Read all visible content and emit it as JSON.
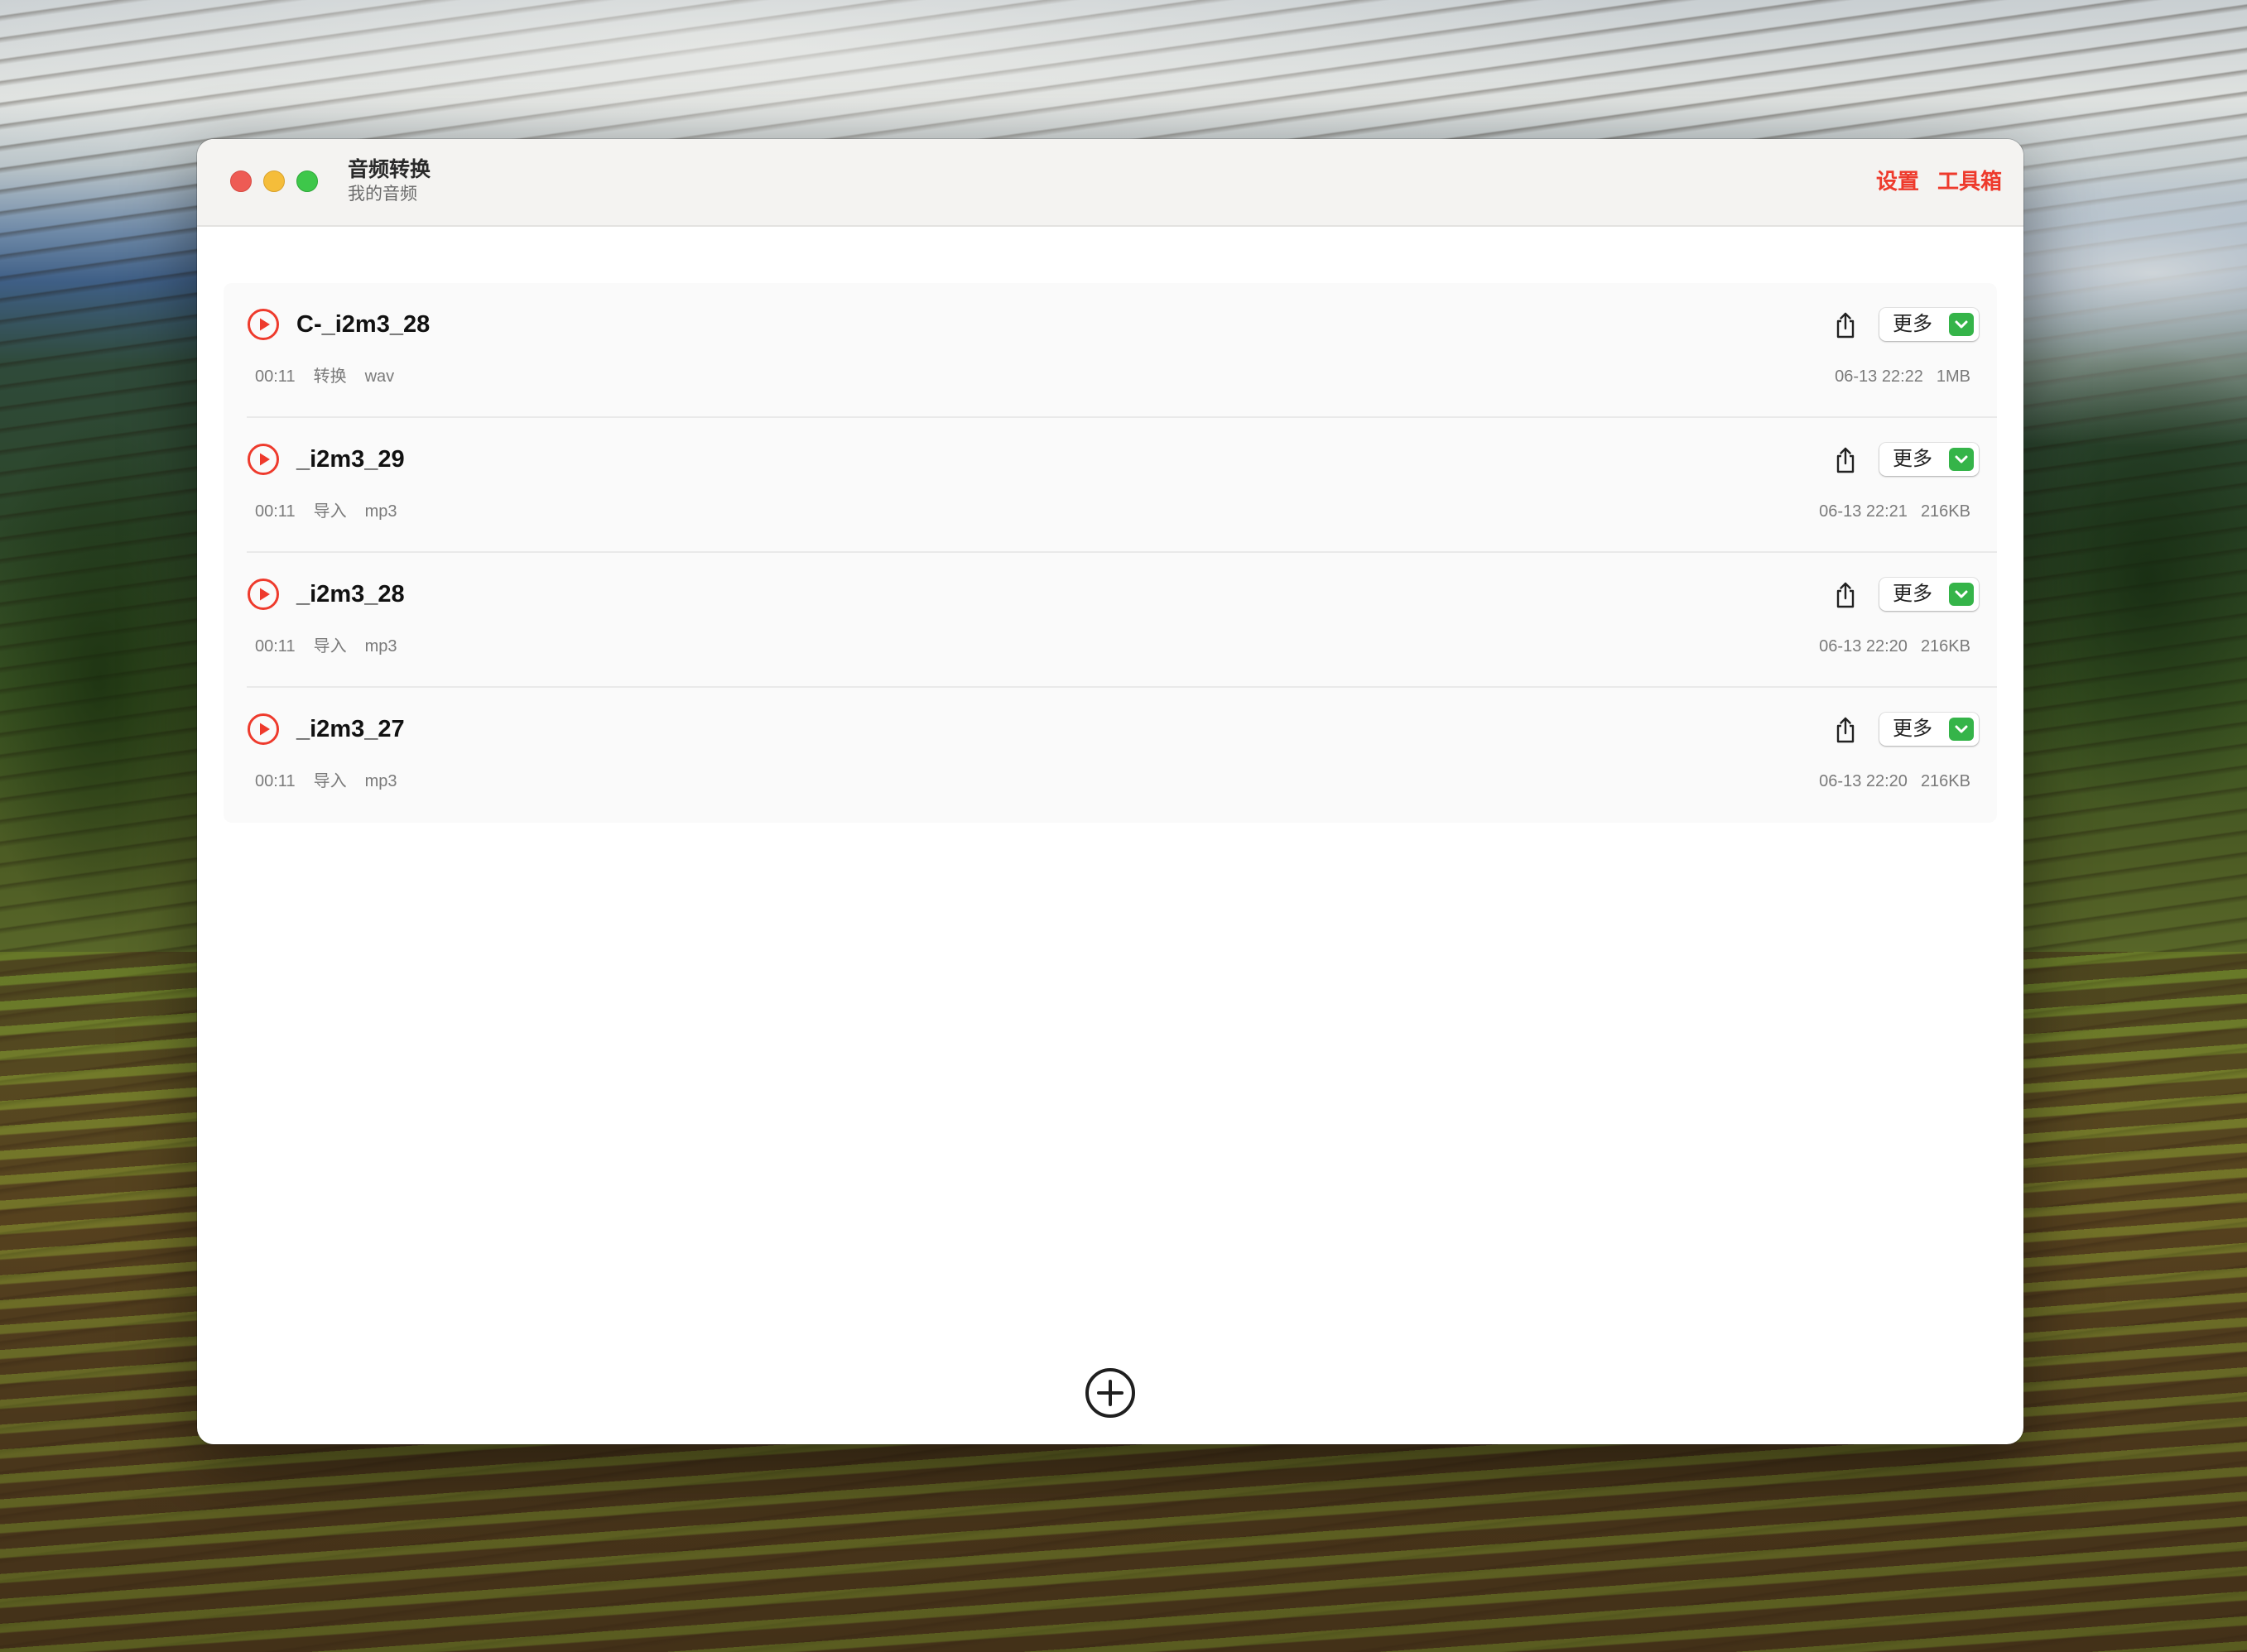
{
  "window": {
    "title": "音频转换",
    "subtitle": "我的音频"
  },
  "header": {
    "settings_label": "设置",
    "toolbox_label": "工具箱",
    "accent_color": "#ee3a2c"
  },
  "recordings": [
    {
      "name": "C-_i2m3_28",
      "duration": "00:11",
      "source": "转换",
      "format": "wav",
      "date": "06-13 22:22",
      "size": "1MB",
      "more_label": "更多"
    },
    {
      "name": "_i2m3_29",
      "duration": "00:11",
      "source": "导入",
      "format": "mp3",
      "date": "06-13 22:21",
      "size": "216KB",
      "more_label": "更多"
    },
    {
      "name": "_i2m3_28",
      "duration": "00:11",
      "source": "导入",
      "format": "mp3",
      "date": "06-13 22:20",
      "size": "216KB",
      "more_label": "更多"
    },
    {
      "name": "_i2m3_27",
      "duration": "00:11",
      "source": "导入",
      "format": "mp3",
      "date": "06-13 22:20",
      "size": "216KB",
      "more_label": "更多"
    }
  ],
  "icons": {
    "play": "play-circle-icon",
    "share": "share-icon",
    "more_dropdown": "chevron-down-icon",
    "add": "plus-circle-icon"
  }
}
